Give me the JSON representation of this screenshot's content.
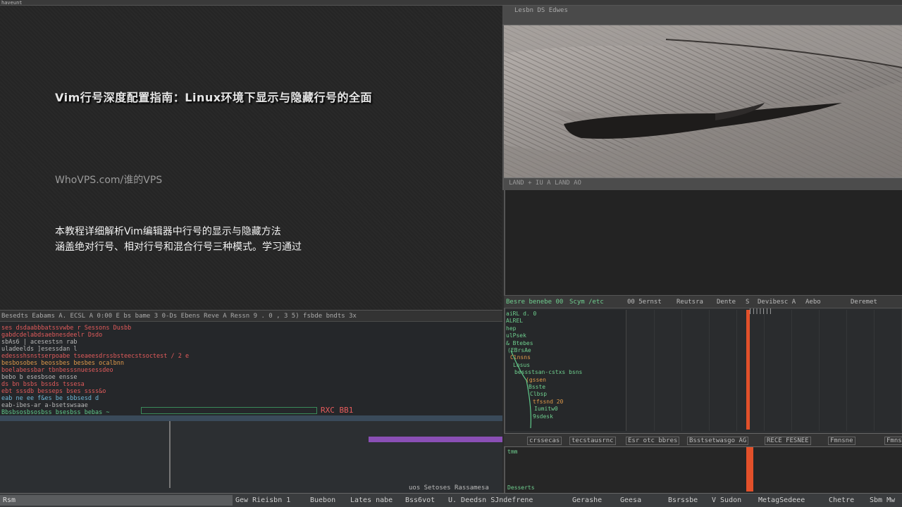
{
  "topbar": {
    "label": "haveunt"
  },
  "hero": {
    "title": "Vim行号深度配置指南：Linux环境下显示与隐藏行号的全面",
    "site": "WhoVPS.com/谁的VPS",
    "desc_line1": "本教程详细解析Vim编辑器中行号的显示与隐藏方法",
    "desc_line2": "涵盖绝对行号、相对行号和混合行号三种模式。学习通过"
  },
  "image_panel": {
    "header": "Lesbn DS Edwes",
    "footer": "LAND + IU  A LAND AO"
  },
  "tool_panel": {
    "tabs": [
      {
        "label": "Besre benebe 00",
        "color": "#6fcf8f"
      },
      {
        "label": "Scym /etc",
        "color": "#6fcf8f"
      },
      {
        "label": "00 5ernst",
        "color": "#bbbbbb"
      },
      {
        "label": "Reutsra",
        "color": "#bbbbbb"
      },
      {
        "label": "Dente",
        "color": "#bbbbbb"
      },
      {
        "label": "S",
        "color": "#bbbbbb"
      },
      {
        "label": "Devibesc A",
        "color": "#bbbbbb"
      },
      {
        "label": "Aebo",
        "color": "#bbbbbb"
      },
      {
        "label": "Deremet",
        "color": "#bbbbbb"
      }
    ],
    "tree": [
      "aiRL d. 0",
      "ALREL",
      "hep",
      "ulPsek",
      "& Btebes",
      "(EBrsAe",
      "Clnsns",
      "Losus",
      "bessstsan-cstxs bsns",
      "(gssen",
      "Bsste",
      "Clbsp",
      "tfssnd 20",
      "Iumitw0",
      "9sdesk"
    ],
    "marker": "|||||||"
  },
  "tool_status": {
    "cells": [
      "crssecas",
      "tecstausrnc",
      "Esr otc bbres",
      "Bsstsetwasgo AG",
      "RECE FESNEE",
      "Fmnsne",
      "Fmnsne"
    ]
  },
  "bottom_right": {
    "line1": "tmm",
    "line2": "Desserts"
  },
  "terminal": {
    "header": "Besedts Eabams  A. ECSL A 0:00  E  bs bame 3  0-Ds Ebens  Reve  A  Ressn  9 . 0 , 3  5)  fsbde bndts 3x",
    "lines": [
      {
        "text": "ses dsdaabbbatssvwbe r  Sessons Dusbb",
        "cls": "c-red"
      },
      {
        "text": "gabdcdelabdsaebnesdeelr Dsdo",
        "cls": "c-red"
      },
      {
        "text": "sbAs6  |     acesestsn rab",
        "cls": "c-gray"
      },
      {
        "text": "uladeelds   ]esessdan l",
        "cls": "c-gray"
      },
      {
        "text": "edessshsnstserpoabe  tseaeesdrssbsteecstsoctest / 2 e",
        "cls": "c-red"
      },
      {
        "text": "besbosobes beossbes besbes  ocalbnn",
        "cls": "c-orange"
      },
      {
        "text": "boelabessbar  tbnbesssnuesessdeo",
        "cls": "c-red"
      },
      {
        "text": "bebo  b  esesbsoe ensse",
        "cls": "c-gray"
      },
      {
        "text": "ds bn  bsbs  bssds tssesa",
        "cls": "c-red"
      },
      {
        "text": "ebt sssdb   besseps bses  ssss&o",
        "cls": "c-red"
      },
      {
        "text": "eab ne ee f&es  be sbbsesd d",
        "cls": "c-cyan"
      },
      {
        "text": "eab-ibes-ar  a-bsetswsaae",
        "cls": "c-gray"
      },
      {
        "text": "Bbsbsosbsosbss bsesbss    bebas     ~",
        "cls": "c-green"
      }
    ],
    "rxc": "RXC BB1",
    "corner": "uos Setoses Rassamesa"
  },
  "taskbar": {
    "left": "Rsm",
    "items": [
      "Gew Rieisbn 1",
      "Buebon",
      "Lates nabe",
      "Bss6vot",
      "U. Deedsn SJndefrene",
      "Gerashe",
      "Geesa",
      "Bsrssbe",
      "V Sudon",
      "MetagSedeee",
      "Chetre",
      "Sbm Mw"
    ]
  }
}
